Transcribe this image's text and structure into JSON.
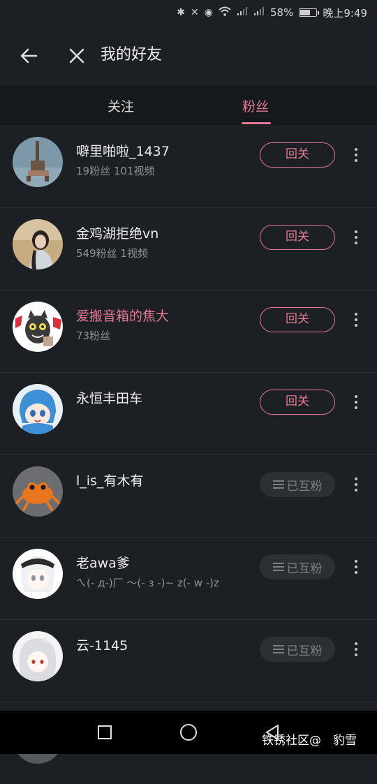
{
  "status_bar": {
    "battery_percent": "58%",
    "time": "晚上9:49",
    "battery_level": 0.58,
    "icons": [
      "bluetooth-icon",
      "mute-icon",
      "eye-icon",
      "wifi-icon",
      "signal-icon",
      "signal-icon",
      "battery-icon"
    ]
  },
  "header": {
    "title": "我的好友"
  },
  "tabs": [
    {
      "label": "关注",
      "active": false
    },
    {
      "label": "粉丝",
      "active": true
    }
  ],
  "buttons": {
    "follow_back": "回关",
    "mutual": "已互粉"
  },
  "users": [
    {
      "name": "噼里啪啦_1437",
      "sub": "19粉丝 101视频",
      "status": "follow_back",
      "highlight": false
    },
    {
      "name": "金鸡湖拒绝vn",
      "sub": "549粉丝 1视频",
      "status": "follow_back",
      "highlight": false
    },
    {
      "name": "爱搬音箱的焦大",
      "sub": "73粉丝",
      "status": "follow_back",
      "highlight": true
    },
    {
      "name": "永恒丰田车",
      "sub": "",
      "status": "follow_back",
      "highlight": false
    },
    {
      "name": "l_is_有木有",
      "sub": "",
      "status": "mutual",
      "highlight": false
    },
    {
      "name": "老awa爹",
      "sub": "ㄟ(- д-)厂 〜(- з -)~ z(- w -)z",
      "status": "mutual",
      "highlight": false
    },
    {
      "name": "云-1145",
      "sub": "",
      "status": "mutual",
      "highlight": false
    }
  ],
  "watermark": "铁锈社区@  豹雪  ",
  "colors": {
    "accent": "#e57893",
    "background": "#1c2024",
    "tab_bar": "#16191c"
  }
}
